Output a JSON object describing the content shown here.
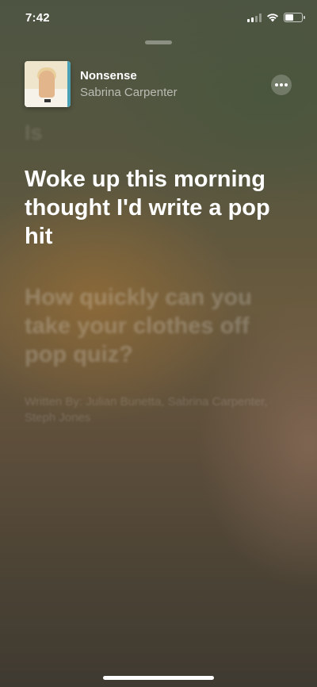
{
  "status_bar": {
    "time": "7:42",
    "battery_level": 0.45
  },
  "now_playing": {
    "title": "Nonsense",
    "artist": "Sabrina Carpenter"
  },
  "lyrics": {
    "previous": "Is",
    "current": "Woke up this morning thought I'd write a pop hit",
    "next": "How quickly can you take your clothes off pop quiz?"
  },
  "credits": "Written By: Julian Bunetta, Sabrina Carpenter, Steph Jones",
  "colors": {
    "accent_edge": "#4aa0b4"
  }
}
